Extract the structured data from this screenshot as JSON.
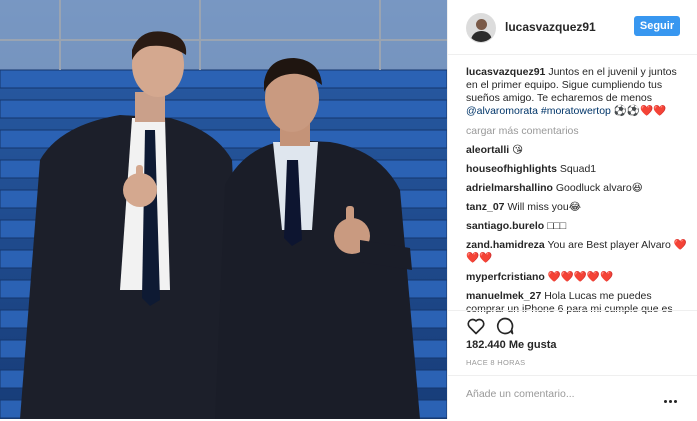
{
  "post": {
    "username": "lucasvazquez91",
    "follow_label": "Seguir",
    "caption_text": "Juntos en el juvenil y juntos en el primer equipo. Sigue cumpliendo tus sueños amigo. Te echaremos de menos",
    "caption_mention": "@alvaromorata",
    "caption_hashtag": "#moratowertop",
    "caption_emoji": "⚽⚽❤️❤️",
    "load_more_label": "cargar más comentarios",
    "comments": [
      {
        "user": "aleortalli",
        "text": "😘"
      },
      {
        "user": "houseofhighlights",
        "text": "Squad1"
      },
      {
        "user": "adrielmarshallino",
        "text": "Goodluck alvaro😆"
      },
      {
        "user": "tanz_07",
        "text": "Will miss you😂"
      },
      {
        "user": "santiago.burelo",
        "text": "□□□"
      },
      {
        "user": "zand.hamidreza",
        "text": "You are Best player Alvaro ❤️❤️❤️"
      },
      {
        "user": "myperfcristiano",
        "text": "❤️❤️❤️❤️❤️"
      },
      {
        "user": "manuelmek_27",
        "text": "Hola Lucas me puedes comprar un iPhone 6 para mi cumple que es"
      }
    ],
    "likes": "182.440 Me gusta",
    "time_ago": "HACE 8 HORAS",
    "comment_placeholder": "Añade un comentario..."
  },
  "icons": {
    "heart": "heart-icon",
    "comment": "comment-icon",
    "more": "more-options-icon"
  },
  "colors": {
    "follow_button": "#3897f0",
    "link": "#003569",
    "muted": "#999999",
    "stadium_seats": "#1d4fa8"
  }
}
